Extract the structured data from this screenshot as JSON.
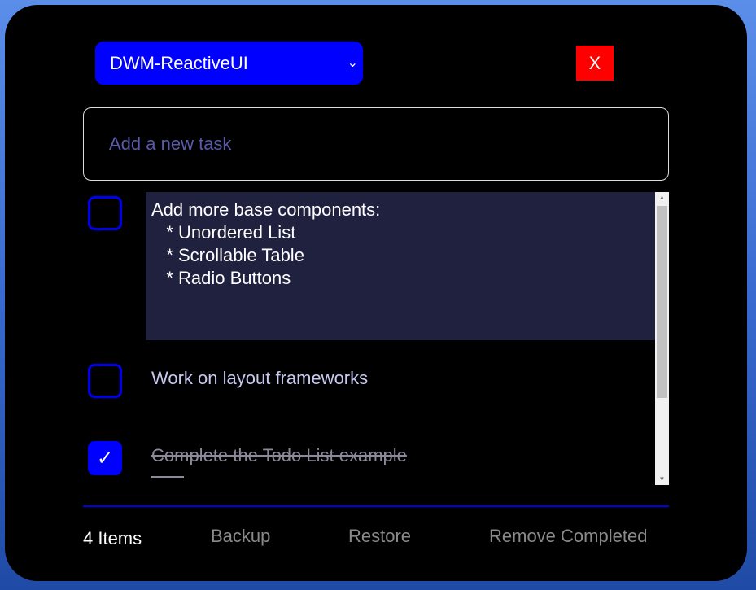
{
  "header": {
    "project_select": "DWM-ReactiveUI",
    "close_label": "X"
  },
  "new_task": {
    "placeholder": "Add a new task"
  },
  "tasks": [
    {
      "text": "Add more base components:\n   * Unordered List\n   * Scrollable Table\n   * Radio Buttons",
      "done": false,
      "editing": true
    },
    {
      "text": "Work on layout frameworks",
      "done": false
    },
    {
      "text": "Complete the Todo List example",
      "done": true
    }
  ],
  "check_glyph": "✓",
  "footer": {
    "count": "4 Items",
    "backup": "Backup",
    "restore": "Restore",
    "remove_completed": "Remove Completed"
  },
  "colors": {
    "accent": "#0000ff",
    "close": "#ff0000",
    "editing_bg": "#20203f"
  }
}
